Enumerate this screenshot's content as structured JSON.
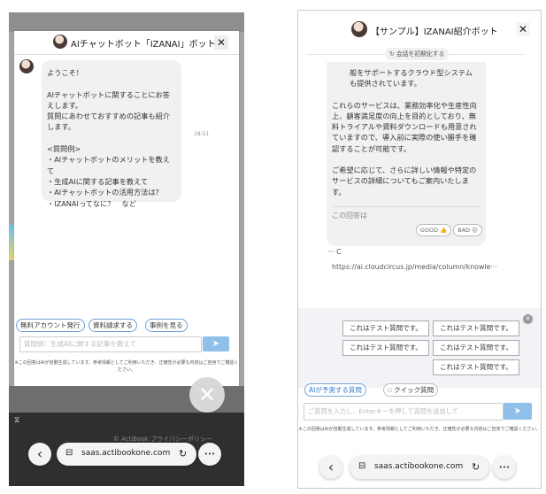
{
  "left": {
    "header_title": "AIチャットボット「IZANAI」ボット",
    "close_glyph": "✕",
    "message": "ようこそ！\n\nAIチャットボットに関することにお答えします。\n質問にあわせておすすめの記事も紹介します。\n\n<質問例>\n・AIチャットボットのメリットを教えて\n・生成AIに関する記事を教えて\n・AIチャットボットの活用方法は？\n・IZANAIってなに？　など",
    "time": "18:51",
    "chips": [
      "無料アカウント発行",
      "資料請求する",
      "事例を見る"
    ],
    "input_placeholder": "質問例：生成AIに関する記事を教えて",
    "send_glyph": "➤",
    "disclaimer": "※この回答はAIが自動生成しています。参考情報としてご利用いただき、正確性が必要な内容はご自身でご確認ください。",
    "overlay_close_glyph": "✕",
    "share_glyph": "⟨⟩",
    "footer_text": "© ActiBook  プライバシーポリシー",
    "browser": {
      "back_glyph": "‹",
      "url": "saas.actibookone.com",
      "reload_glyph": "↻",
      "more_glyph": "•••",
      "tab_glyph": "⊟"
    }
  },
  "right": {
    "header_title": "【サンプル】IZANAI紹介ボット",
    "close_glyph": "✕",
    "reset_label": "会話を初期化する",
    "reset_glyph": "↻",
    "answer_lines_top": "般をサポートするクラウド型システム\nも提供されています。",
    "answer_para2": "これらのサービスは、業務効率化や生産性向上、顧客満足度の向上を目的としており、無料トライアルや資料ダウンロードも用意されていますので、導入前に実際の使い勝手を確認することが可能です。",
    "answer_para3": "ご希望に応じて、さらに詳しい情報や特定のサービスの詳細についてもご案内いたします。",
    "rating_label": "この回答は",
    "good_label": "GOOD",
    "bad_label": "BAD",
    "source_prefix": "··· C",
    "source_url": "https://ai.cloudcircus.jp/media/column/knowle···",
    "test_buttons": [
      "これはテスト質問です。",
      "これはテスト質問です。",
      "これはテスト質問です。",
      "これはテスト質問です。",
      "これはテスト質問です。"
    ],
    "dismiss_glyph": "✕",
    "tabs": [
      "AIが予測する質問",
      "クイック質問"
    ],
    "input_placeholder": "ご質問を入力し、Enterキーを押して質問を送信して",
    "send_glyph": "➤",
    "disclaimer": "※この回答はAIが自動生成しています。参考情報としてご利用いただき、正確性が必要な内容はご自身でご確認ください。",
    "browser": {
      "back_glyph": "‹",
      "url": "saas.actibookone.com",
      "reload_glyph": "↻",
      "more_glyph": "•••",
      "tab_glyph": "⊟"
    }
  }
}
